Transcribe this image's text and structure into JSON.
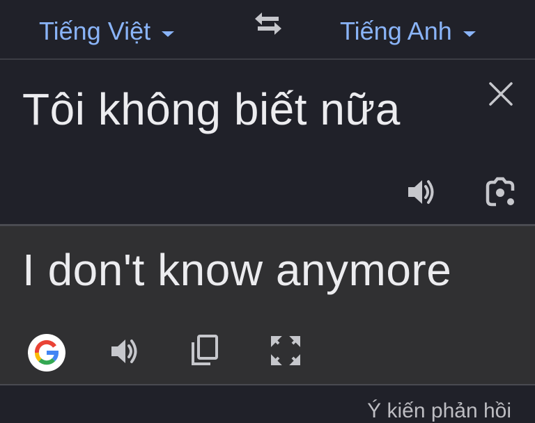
{
  "languages": {
    "source": "Tiếng Việt",
    "target": "Tiếng Anh"
  },
  "input": {
    "text": "Tôi không biết nữa"
  },
  "output": {
    "text": "I don't know anymore"
  },
  "footer": {
    "feedback": "Ý kiến phản hồi"
  },
  "colors": {
    "background": "#202129",
    "output_background": "#303032",
    "accent": "#8ab4f8",
    "text": "#ececef",
    "icon": "#c6c7cc"
  },
  "icons": [
    "swap-icon",
    "close-icon",
    "speaker-icon",
    "camera-icon",
    "google-icon",
    "copy-icon",
    "fullscreen-icon"
  ]
}
